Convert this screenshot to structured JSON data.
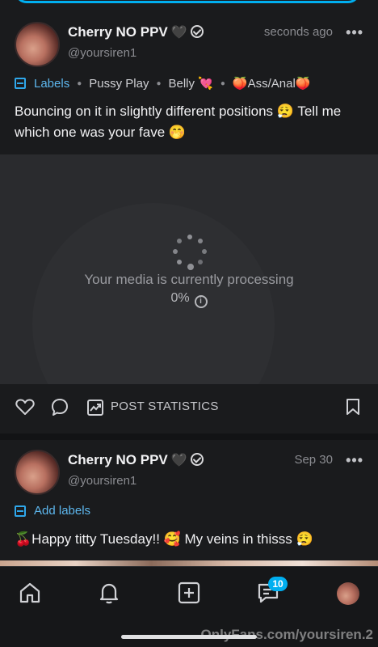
{
  "posts": [
    {
      "author": "Cherry NO PPV",
      "author_emoji": "🖤",
      "handle": "@yoursiren1",
      "time": "seconds ago",
      "labels_title": "Labels",
      "labels": [
        "Pussy Play",
        "Belly 💘",
        "🍑Ass/Anal🍑"
      ],
      "text": "Bouncing on it in slightly different positions 😮‍💨 Tell me which one was your fave 🤭",
      "media_status": "Your media is currently processing",
      "media_progress": "0%",
      "stats_label": "POST STATISTICS"
    },
    {
      "author": "Cherry NO PPV",
      "author_emoji": "🖤",
      "handle": "@yoursiren1",
      "time": "Sep 30",
      "add_labels": "Add labels",
      "text": "🍒Happy titty Tuesday!! 🥰 My veins in thisss 😮‍💨"
    }
  ],
  "nav": {
    "items": [
      "home-icon",
      "bell-icon",
      "add-post-icon",
      "messages-icon",
      "profile-avatar"
    ],
    "messages_badge": "10"
  },
  "watermark": "OnlyFans.com/yoursiren.2",
  "colors": {
    "accent": "#00aff0",
    "background": "#1a1b1d"
  }
}
